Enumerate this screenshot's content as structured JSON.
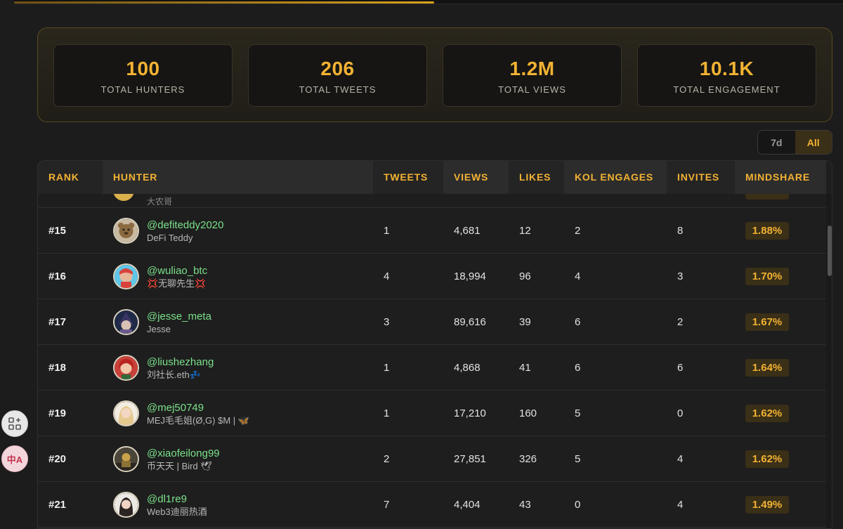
{
  "stats": [
    {
      "value": "100",
      "label": "TOTAL HUNTERS"
    },
    {
      "value": "206",
      "label": "TOTAL TWEETS"
    },
    {
      "value": "1.2M",
      "label": "TOTAL VIEWS"
    },
    {
      "value": "10.1K",
      "label": "TOTAL ENGAGEMENT"
    }
  ],
  "range_toggle": {
    "option_7d": "7d",
    "option_all": "All",
    "selected": "All"
  },
  "table": {
    "headers": {
      "rank": "RANK",
      "hunter": "HUNTER",
      "tweets": "TWEETS",
      "views": "VIEWS",
      "likes": "LIKES",
      "kol": "KOL ENGAGES",
      "invites": "INVITES",
      "mindshare": "MINDSHARE"
    },
    "partial_row_name": "大农哥",
    "rows": [
      {
        "rank": "#15",
        "handle": "@defiteddy2020",
        "name": "DeFi Teddy",
        "tweets": "1",
        "views": "4,681",
        "likes": "12",
        "kol": "2",
        "invites": "8",
        "mindshare": "1.88%"
      },
      {
        "rank": "#16",
        "handle": "@wuliao_btc",
        "name": "💢无聊先生💢",
        "tweets": "4",
        "views": "18,994",
        "likes": "96",
        "kol": "4",
        "invites": "3",
        "mindshare": "1.70%"
      },
      {
        "rank": "#17",
        "handle": "@jesse_meta",
        "name": "Jesse",
        "tweets": "3",
        "views": "89,616",
        "likes": "39",
        "kol": "6",
        "invites": "2",
        "mindshare": "1.67%"
      },
      {
        "rank": "#18",
        "handle": "@liushezhang",
        "name": "刘社长.eth💤",
        "tweets": "1",
        "views": "4,868",
        "likes": "41",
        "kol": "6",
        "invites": "6",
        "mindshare": "1.64%"
      },
      {
        "rank": "#19",
        "handle": "@mej50749",
        "name": "MEJ毛毛姐(Ø,G) $M | 🦋",
        "tweets": "1",
        "views": "17,210",
        "likes": "160",
        "kol": "5",
        "invites": "0",
        "mindshare": "1.62%"
      },
      {
        "rank": "#20",
        "handle": "@xiaofeilong99",
        "name": "币天天 | Bird 🕊",
        "tweets": "2",
        "views": "27,851",
        "likes": "326",
        "kol": "5",
        "invites": "4",
        "mindshare": "1.62%"
      },
      {
        "rank": "#21",
        "handle": "@dl1re9",
        "name": "Web3迪丽热酒",
        "tweets": "7",
        "views": "4,404",
        "likes": "43",
        "kol": "0",
        "invites": "4",
        "mindshare": "1.49%"
      }
    ]
  },
  "sidebar_tools": {
    "grid_icon": "grid-plus-icon",
    "translate_icon": "translate-icon",
    "translate_glyph": "中A"
  },
  "colors": {
    "accent": "#f2b233",
    "handle": "#7be08a",
    "background": "#1c1c1c"
  }
}
